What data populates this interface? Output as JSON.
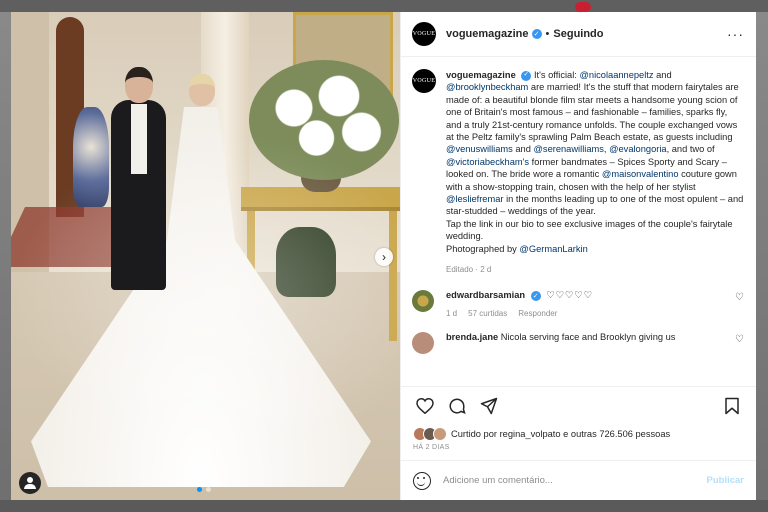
{
  "post": {
    "username": "voguemagazine",
    "avatar_text": "VOGUE",
    "header_separator": "•",
    "follow_status": "Seguindo",
    "caption_parts": [
      {
        "t": "It's official: ",
        "m": false
      },
      {
        "t": "@nicolaannepeltz",
        "m": true
      },
      {
        "t": " and ",
        "m": false
      },
      {
        "t": "@brooklynbeckham",
        "m": true
      },
      {
        "t": " are married! It's the stuff that modern fairytales are made of: a beautiful blonde film star meets a handsome young scion of one of Britain's most famous – and fashionable – families, sparks fly, and a truly 21st-century romance unfolds. The couple exchanged vows at the Peltz family's sprawling Palm Beach estate, as guests including ",
        "m": false
      },
      {
        "t": "@venuswilliams",
        "m": true
      },
      {
        "t": " and ",
        "m": false
      },
      {
        "t": "@serenawilliams",
        "m": true
      },
      {
        "t": ", ",
        "m": false
      },
      {
        "t": "@evalongoria",
        "m": true
      },
      {
        "t": ", and two of ",
        "m": false
      },
      {
        "t": "@victoriabeckham's",
        "m": true
      },
      {
        "t": " former bandmates – Spices Sporty and Scary – looked on. The bride wore a romantic ",
        "m": false
      },
      {
        "t": "@maisonvalentino",
        "m": true
      },
      {
        "t": " couture gown with a show-stopping train, chosen with the help of her stylist ",
        "m": false
      },
      {
        "t": "@lesliefremar",
        "m": true
      },
      {
        "t": " in the months leading up to one of the most opulent – and star-studded – weddings of the year.\nTap the link in our bio to see exclusive images of the couple's fairytale wedding.\nPhotographed by ",
        "m": false
      },
      {
        "t": "@GermanLarkin",
        "m": true
      }
    ],
    "edited": "Editado · 2 d",
    "likes_text": "Curtido por regina_volpato e outras 726.506 pessoas",
    "timestamp": "HÁ 2 DIAS"
  },
  "comments": [
    {
      "username": "edwardbarsamian",
      "text": "♡♡♡♡♡",
      "time": "1 d",
      "likes": "57 curtidas",
      "reply": "Responder",
      "like_icon": "♡"
    },
    {
      "username": "brenda.jane",
      "text": "Nicola serving face and Brooklyn giving us",
      "time": "",
      "likes": "",
      "reply": "",
      "like_icon": "♡"
    }
  ],
  "composer": {
    "placeholder": "Adicione um comentário...",
    "publish": "Publicar"
  },
  "media": {
    "next_label": "›"
  },
  "icons": [
    "heart-icon",
    "comment-icon",
    "share-icon",
    "bookmark-icon",
    "emoji-icon",
    "user-tag-icon",
    "more-options-icon",
    "verified-icon",
    "chevron-right-icon"
  ],
  "colors": {
    "link": "#00376b",
    "verified": "#3897f0",
    "publish": "#b2dffc",
    "meta": "#8e8e8e",
    "active_dot": "#0095f6"
  }
}
